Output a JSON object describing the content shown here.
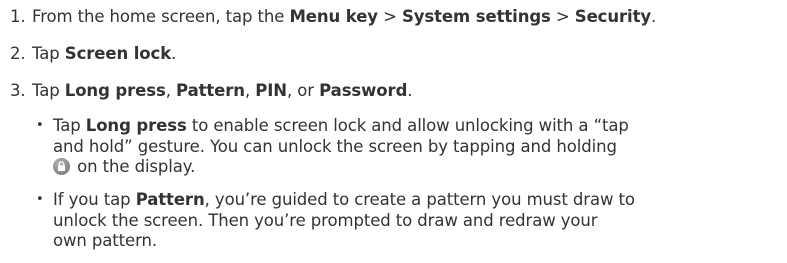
{
  "steps": [
    {
      "num": "1.",
      "t1": "From the home screen, tap the ",
      "b1": "Menu key",
      "t2": " > ",
      "b2": "System settings",
      "t3": " > ",
      "b3": "Security",
      "t4": "."
    },
    {
      "num": "2.",
      "t1": "Tap ",
      "b1": "Screen lock",
      "t2": "."
    },
    {
      "num": "3.",
      "t1": "Tap ",
      "b1": "Long press",
      "t2": ", ",
      "b2": "Pattern",
      "t3": ", ",
      "b3": "PIN",
      "t4": ", or ",
      "b4": "Password",
      "t5": "."
    }
  ],
  "bullets": [
    {
      "dot": "•",
      "l1a": "Tap ",
      "l1b": "Long press",
      "l1c": " to enable screen lock and allow unlocking with a “tap",
      "l2": "and hold” gesture. You can unlock the screen by tapping and holding",
      "icon": "lock-icon",
      "l3": " on the display."
    },
    {
      "dot": "•",
      "l1a": "If you tap ",
      "l1b": "Pattern",
      "l1c": ", you’re guided to create a pattern you must draw to",
      "l2": "unlock the screen. Then you’re prompted to draw and redraw your",
      "l3": "own pattern."
    }
  ]
}
